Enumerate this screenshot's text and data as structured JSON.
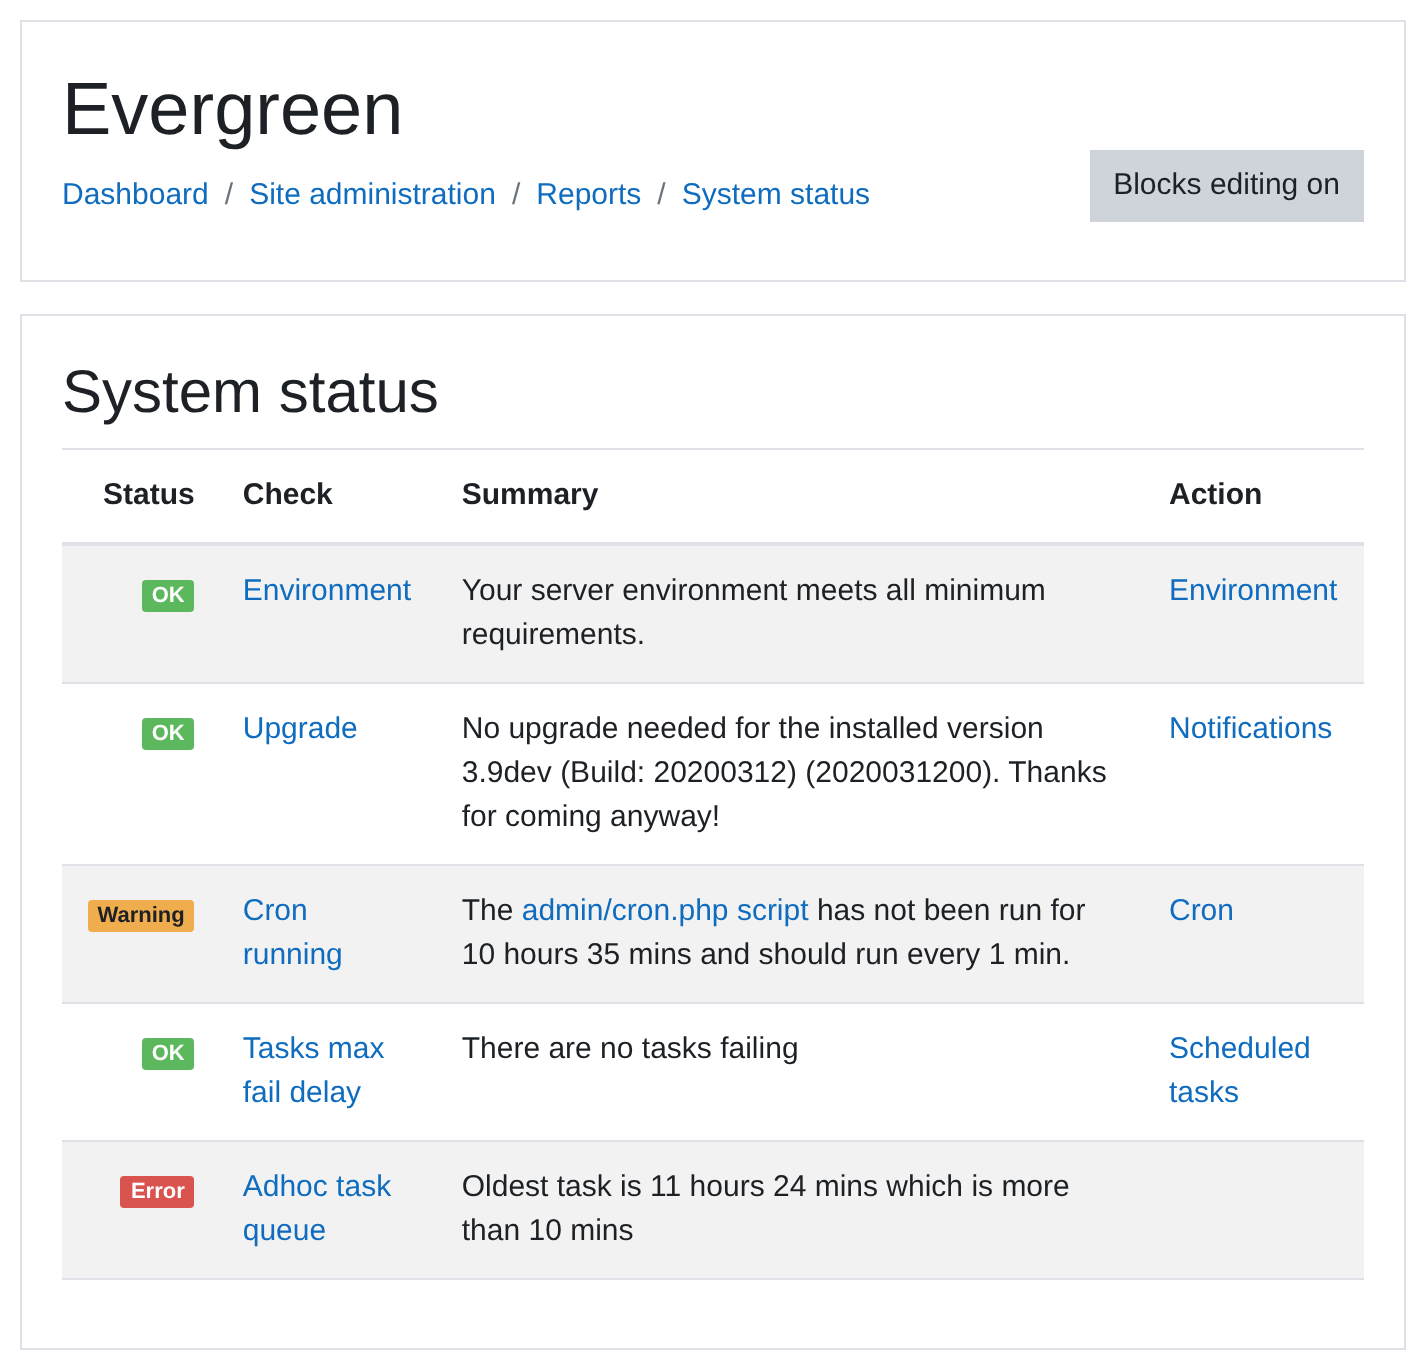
{
  "header": {
    "title": "Evergreen",
    "breadcrumbs": [
      "Dashboard",
      "Site administration",
      "Reports",
      "System status"
    ],
    "separator": "/",
    "button": "Blocks editing on"
  },
  "page_title": "System status",
  "table": {
    "columns": [
      "Status",
      "Check",
      "Summary",
      "Action"
    ],
    "rows": [
      {
        "status": {
          "kind": "ok",
          "label": "OK"
        },
        "check": "Environment",
        "summary": "Your server environment meets all minimum requirements.",
        "action": "Environment"
      },
      {
        "status": {
          "kind": "ok",
          "label": "OK"
        },
        "check": "Upgrade",
        "summary": "No upgrade needed for the installed version 3.9dev (Build: 20200312) (2020031200). Thanks for coming anyway!",
        "action": "Notifications"
      },
      {
        "status": {
          "kind": "warning",
          "label": "Warning"
        },
        "check": "Cron running",
        "summary": "The ",
        "summary_link": "admin/cron.php script",
        "summary_after": " has not been run for 10 hours 35 mins and should run every 1 min.",
        "action": "Cron"
      },
      {
        "status": {
          "kind": "ok",
          "label": "OK"
        },
        "check": "Tasks max fail delay",
        "summary": "There are no tasks failing",
        "action": "Scheduled tasks"
      },
      {
        "status": {
          "kind": "error",
          "label": "Error"
        },
        "check": "Adhoc task queue",
        "summary": "Oldest task is 11 hours 24 mins which is more than 10 mins"
      }
    ]
  }
}
